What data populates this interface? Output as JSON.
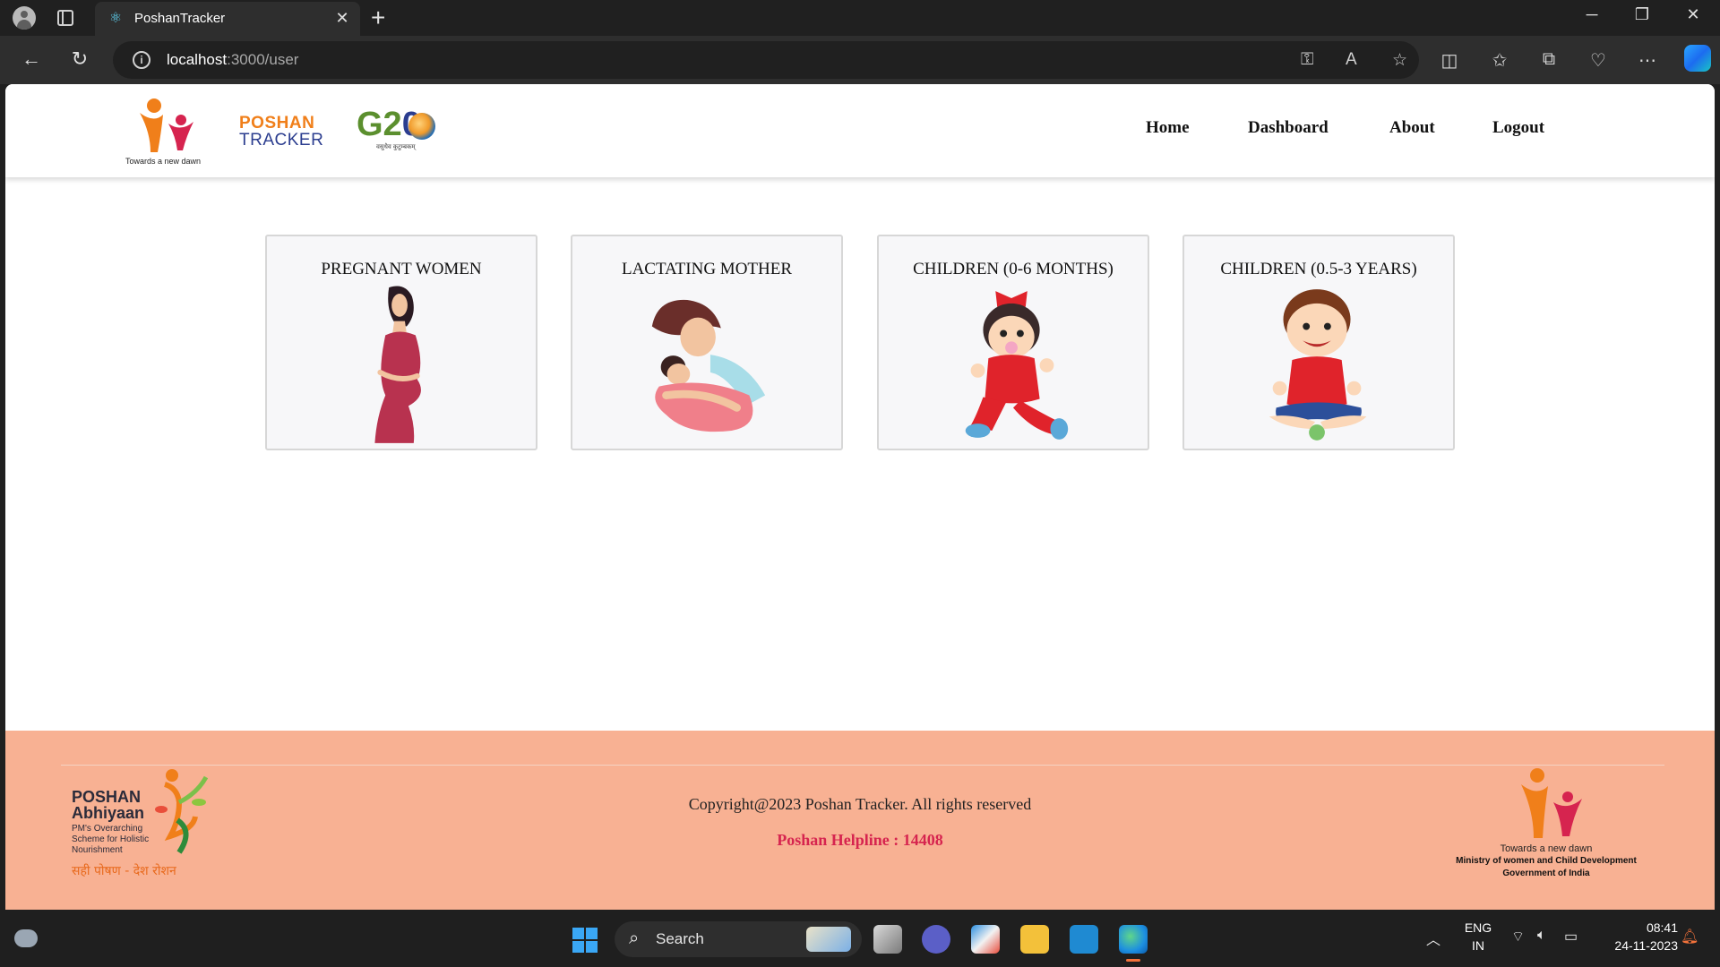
{
  "browser": {
    "tab_title": "PoshanTracker",
    "url_host": "localhost",
    "url_path": ":3000/user",
    "new_tab_symbol": "+",
    "close_symbol": "✕"
  },
  "site": {
    "logo_caption": "Towards a new dawn",
    "poshan_line1": "POSHAN",
    "poshan_line2": "TRACKER",
    "g20_text": "G2",
    "g20_zero": "0",
    "g20_sub": "वसुधैव कुटुम्बकम्",
    "nav": [
      {
        "label": "Home"
      },
      {
        "label": "Dashboard"
      },
      {
        "label": "About"
      },
      {
        "label": "Logout"
      }
    ],
    "cards": [
      {
        "title": "PREGNANT WOMEN"
      },
      {
        "title": "LACTATING MOTHER"
      },
      {
        "title": "CHILDREN (0-6 MONTHS)"
      },
      {
        "title": "CHILDREN (0.5-3 YEARS)"
      }
    ],
    "footer": {
      "left_logo_line1": "POSHAN",
      "left_logo_line2": "Abhiyaan",
      "left_logo_tagline": "PM's Overarching Scheme for Holistic Nourishment",
      "left_logo_hindi": "सही पोषण - देश रोशन",
      "copyright": "Copyright@2023 Poshan Tracker. All rights reserved",
      "helpline": "Poshan Helpline : 14408",
      "right_caption": "Towards a new dawn",
      "right_ministry": "Ministry of women and Child Development",
      "right_gov": "Government of India"
    }
  },
  "taskbar": {
    "search_label": "Search",
    "lang_line1": "ENG",
    "lang_line2": "IN",
    "time": "08:41",
    "date": "24-11-2023"
  },
  "colors": {
    "brand_orange": "#f07f1a",
    "brand_navy": "#2b3d8f",
    "footer_bg": "#f8b193",
    "helpline_red": "#d6244f",
    "card_bg": "#f7f7f9"
  }
}
